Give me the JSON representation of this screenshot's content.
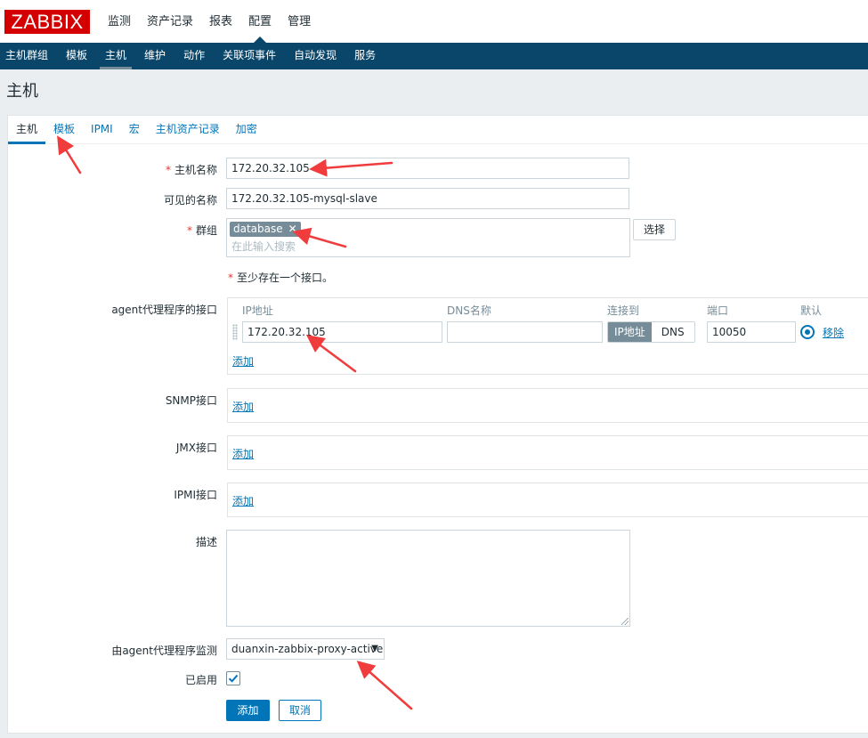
{
  "logo": "ZABBIX",
  "main_menu": [
    "监测",
    "资产记录",
    "报表",
    "配置",
    "管理"
  ],
  "sub_menu": [
    "主机群组",
    "模板",
    "主机",
    "维护",
    "动作",
    "关联项事件",
    "自动发现",
    "服务"
  ],
  "page_title": "主机",
  "tabs": [
    "主机",
    "模板",
    "IPMI",
    "宏",
    "主机资产记录",
    "加密"
  ],
  "form": {
    "host_name_label": "主机名称",
    "host_name_value": "172.20.32.105",
    "visible_name_label": "可见的名称",
    "visible_name_value": "172.20.32.105-mysql-slave",
    "groups_label": "群组",
    "group_chip": "database",
    "group_remove": "✕",
    "groups_placeholder": "在此输入搜索",
    "select_button": "选择",
    "required_mark": "*",
    "interface_note": "至少存在一个接口。",
    "agent_label": "agent代理程序的接口",
    "col_ip": "IP地址",
    "col_dns": "DNS名称",
    "col_connect": "连接到",
    "col_port": "端口",
    "col_default": "默认",
    "agent_ip": "172.20.32.105",
    "agent_dns": "",
    "connect_ip": "IP地址",
    "connect_dns": "DNS",
    "agent_port": "10050",
    "remove_link": "移除",
    "add_link": "添加",
    "snmp_label": "SNMP接口",
    "jmx_label": "JMX接口",
    "ipmi_label": "IPMI接口",
    "description_label": "描述",
    "description_value": "",
    "proxy_label": "由agent代理程序监测",
    "proxy_value": "duanxin-zabbix-proxy-active",
    "proxy_arrow": "▼",
    "enabled_label": "已启用",
    "enabled": true,
    "add_button": "添加",
    "cancel_button": "取消"
  },
  "colors": {
    "brand": "#d40000",
    "nav": "#0a466a",
    "accent": "#0275b8",
    "annotation_arrow": "#f03c3c"
  }
}
